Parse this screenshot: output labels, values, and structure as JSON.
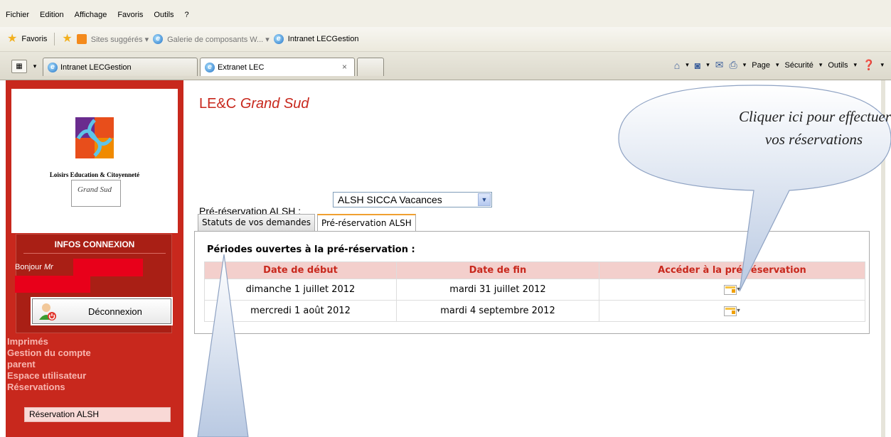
{
  "browser": {
    "menu": [
      "Fichier",
      "Edition",
      "Affichage",
      "Favoris",
      "Outils",
      "?"
    ],
    "favorites_label": "Favoris",
    "fav_links": [
      "Sites suggérés ▾",
      "Galerie de composants W... ▾",
      "Intranet LECGestion"
    ],
    "tabs": [
      {
        "label": "Intranet LECGestion",
        "active": false
      },
      {
        "label": "Extranet LEC",
        "active": true
      }
    ],
    "tab_close": "×",
    "commands": {
      "page": "Page",
      "security": "Sécurité",
      "tools": "Outils"
    }
  },
  "sidebar": {
    "logo_line1": "Loisirs Education & Citoyenneté",
    "logo_line2": "Grand Sud",
    "infos_title": "INFOS CONNEXION",
    "greeting": "Bonjour",
    "greeting_name": "Mr",
    "logout_label": "Déconnexion",
    "links": [
      "Imprimés",
      "Gestion du compte",
      "parent",
      "Espace utilisateur",
      "Réservations"
    ],
    "active_link": "Réservation ALSH"
  },
  "main": {
    "title_brand": "LE&C",
    "title_region": "Grand Sud",
    "preselection_label": "Pré-réservation ALSH :",
    "select_value": "ALSH SICCA Vacances",
    "tabs": [
      "Statuts de vos demandes",
      "Pré-réservation ALSH"
    ],
    "periods_title": "Périodes ouvertes à la pré-réservation :",
    "table": {
      "headers": [
        "Date de début",
        "Date de fin",
        "Accéder à la pré-réservation"
      ],
      "rows": [
        [
          "dimanche 1 juillet 2012",
          "mardi 31 juillet 2012"
        ],
        [
          "mercredi 1 août 2012",
          "mardi 4 septembre 2012"
        ]
      ]
    }
  },
  "callout": {
    "line1": "Cliquer ici pour effectuer",
    "line2": "vos réservations"
  },
  "colors": {
    "brand_red": "#c8281d",
    "header_pink": "#f3cfcc"
  }
}
